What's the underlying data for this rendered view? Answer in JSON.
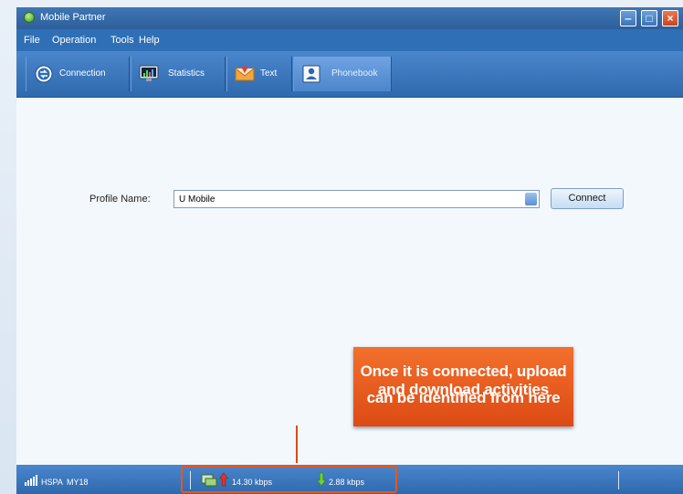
{
  "window": {
    "title": "Mobile Partner"
  },
  "menu": [
    "File",
    "Operation",
    "Tools",
    "Help"
  ],
  "tabs": [
    {
      "label": "Connection",
      "icon": "connection-icon"
    },
    {
      "label": "Statistics",
      "icon": "statistics-icon"
    },
    {
      "label": "Text",
      "icon": "text-envelope-icon"
    },
    {
      "label": "Phonebook",
      "icon": "phonebook-icon",
      "active": true
    }
  ],
  "connection": {
    "profile_label": "Profile Name:",
    "profile_value": "U Mobile",
    "connect_label": "Connect"
  },
  "callout": {
    "line1": "Once it is connected, upload and download activities",
    "line2": "can be identified from here"
  },
  "status": {
    "network_type": "HSPA",
    "operator": "MY18",
    "upload_rate": "14.30 kbps",
    "download_rate": "2.88 kbps"
  },
  "colors": {
    "accent_orange": "#e8561d",
    "window_blue": "#3a76bd"
  }
}
